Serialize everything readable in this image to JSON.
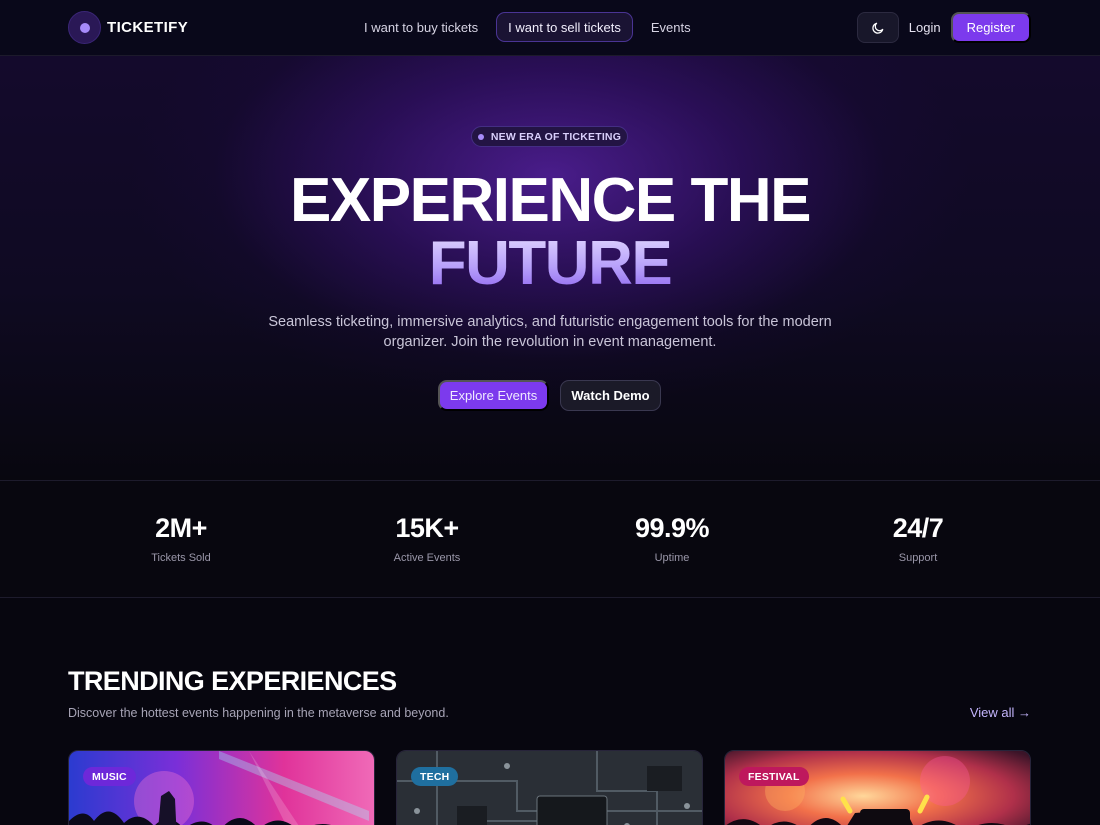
{
  "brand": {
    "name": "TICKETIFY",
    "accent": "#7c3aed"
  },
  "nav": {
    "links": [
      {
        "label": "I want to buy tickets",
        "active": false
      },
      {
        "label": "I want to sell tickets",
        "active": true
      },
      {
        "label": "Events",
        "active": false
      }
    ],
    "theme_icon": "moon-icon",
    "login_label": "Login",
    "register_label": "Register"
  },
  "hero": {
    "badge": "NEW ERA OF TICKETING",
    "title_line1": "EXPERIENCE THE",
    "title_line2": "FUTURE",
    "subtitle": "Seamless ticketing, immersive analytics, and futuristic engagement tools for the modern organizer. Join the revolution in event management.",
    "primary_cta": "Explore Events",
    "secondary_cta": "Watch Demo"
  },
  "stats": [
    {
      "value": "2M+",
      "label": "Tickets Sold"
    },
    {
      "value": "15K+",
      "label": "Active Events"
    },
    {
      "value": "99.9%",
      "label": "Uptime"
    },
    {
      "value": "24/7",
      "label": "Support"
    }
  ],
  "trending": {
    "title": "TRENDING EXPERIENCES",
    "subtitle": "Discover the hottest events happening in the metaverse and beyond.",
    "view_all": "View all →",
    "cards": [
      {
        "tag": "MUSIC",
        "tag_color": "#6d28d9"
      },
      {
        "tag": "TECH",
        "tag_color": "#1f6f9f"
      },
      {
        "tag": "FESTIVAL",
        "tag_color": "#be185d"
      }
    ]
  }
}
